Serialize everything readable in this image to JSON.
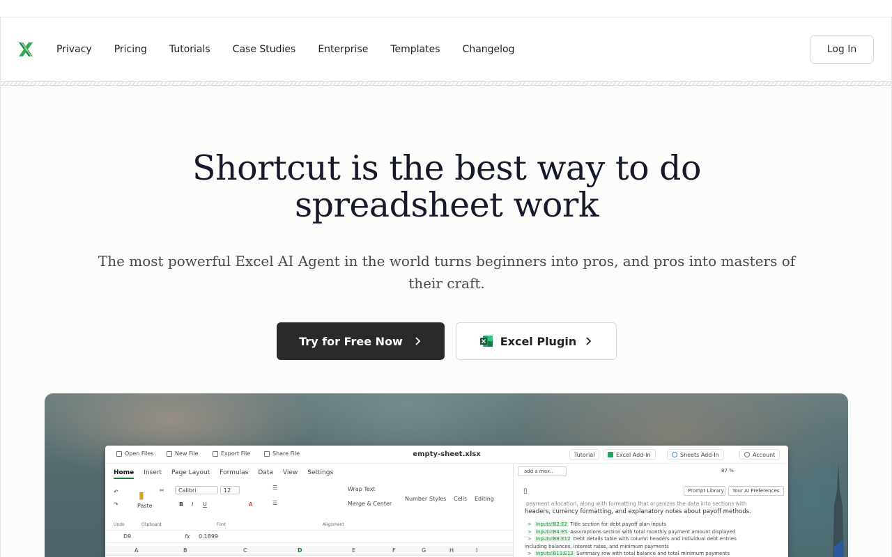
{
  "nav": {
    "logo_icon": "shortcut-x-logo-icon",
    "links": [
      "Privacy",
      "Pricing",
      "Tutorials",
      "Case Studies",
      "Enterprise",
      "Templates",
      "Changelog"
    ],
    "login_label": "Log In"
  },
  "hero": {
    "title": "Shortcut is the best way to do spreadsheet work",
    "subtitle": "The most powerful Excel AI Agent in the world turns beginners into pros, and pros into masters of their craft.",
    "primary_cta": "Try for Free Now",
    "secondary_cta": "Excel Plugin"
  },
  "app_preview": {
    "top_buttons": [
      "Open Files",
      "New File",
      "Export File",
      "Share File"
    ],
    "file_title": "empty-sheet.xlsx",
    "top_right": [
      "Tutorial",
      "Excel Add-In",
      "Sheets Add-In",
      "Account"
    ],
    "tabs": [
      "Home",
      "Insert",
      "Page Layout",
      "Formulas",
      "Data",
      "View",
      "Settings"
    ],
    "ribbon": {
      "paste": "Paste",
      "font_name": "Calibri",
      "font_size": "12",
      "wrap": "Wrap Text",
      "merge": "Merge & Center",
      "number": "Number",
      "styles": "Styles",
      "cells": "Cells",
      "editing": "Editing",
      "groups": [
        "Undo",
        "Clipboard",
        "Font",
        "Alignment"
      ]
    },
    "cell_ref": "D9",
    "formula_value": "0.1899",
    "columns": [
      "A",
      "B",
      "C",
      "D",
      "E",
      "F",
      "G",
      "H",
      "I"
    ],
    "side": {
      "input_text": "add a max..",
      "zoom": "87 %",
      "prompt_library": "Prompt Library",
      "ai_prefs": "Your AI Preferences",
      "para_line1": "payment allocation, along with formatting that organizes the data into sections with",
      "para_line2": "headers, currency formatting, and explanatory notes about payoff methods.",
      "bullets": [
        {
          "ref": "Inputs!B2:E2",
          "text": "Title section for debt payoff plan inputs"
        },
        {
          "ref": "Inputs!B4:E5",
          "text": "Assumptions section with total monthly payment amount displayed"
        },
        {
          "ref": "Inputs!B8:E12",
          "text": "Debt details table with column headers and individual debt entries"
        },
        {
          "ref": "",
          "text": "including balances, interest rates, and minimum payments"
        },
        {
          "ref": "Inputs!B13:E13",
          "text": "Summary row with total balance and total minimum payments"
        }
      ]
    }
  },
  "colors": {
    "accent_green": "#1f7a3a",
    "primary_button": "#2a2a2a",
    "title_text": "#15192a"
  }
}
